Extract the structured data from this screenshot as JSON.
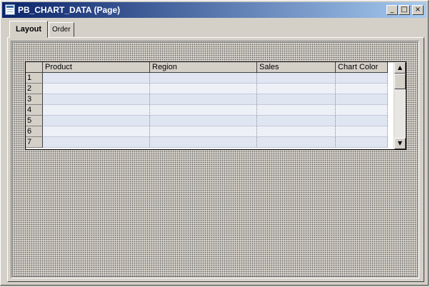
{
  "window": {
    "title": "PB_CHART_DATA (Page)",
    "controls": {
      "minimize": "_",
      "maximize": "□",
      "close": "×"
    }
  },
  "tabs": [
    {
      "label": "Layout",
      "active": true
    },
    {
      "label": "Order",
      "active": false
    }
  ],
  "grid": {
    "columns": [
      "Product",
      "Region",
      "Sales",
      "Chart Color"
    ],
    "row_numbers": [
      "1",
      "2",
      "3",
      "4",
      "5",
      "6",
      "7"
    ],
    "scroll_up": "▲",
    "scroll_down": "▼"
  },
  "colors": {
    "titlebar_start": "#0a246a",
    "titlebar_end": "#a6caf0",
    "row_odd": "#dfe6f2",
    "row_even": "#eef0f8"
  }
}
